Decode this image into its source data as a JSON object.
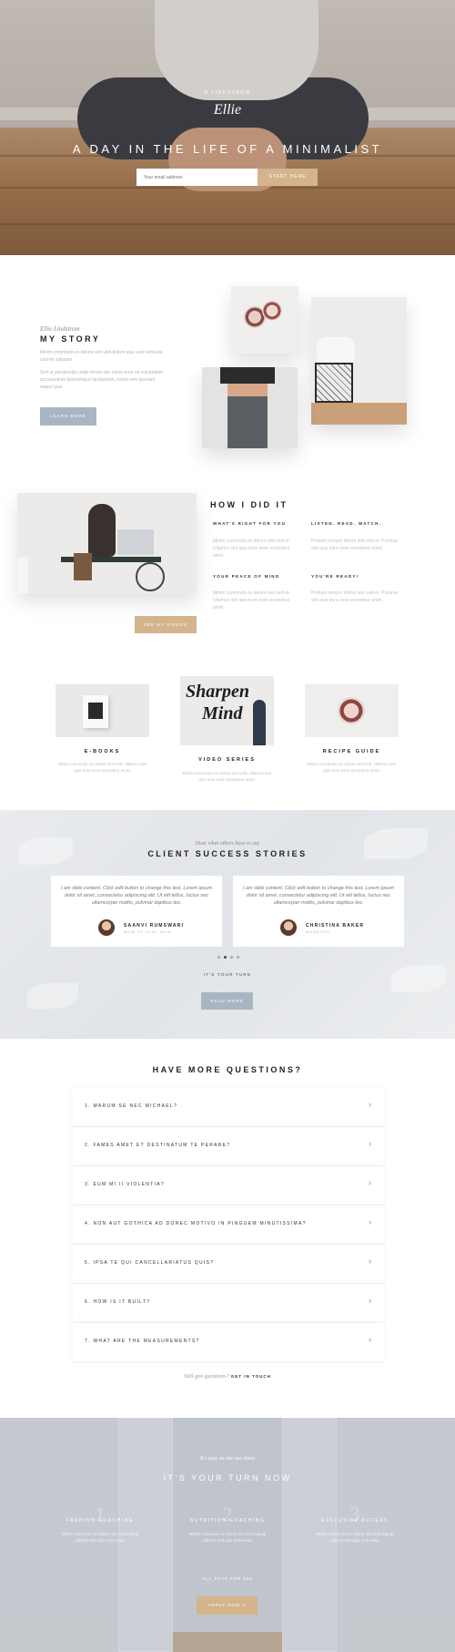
{
  "hero": {
    "byline": "D LINDSTROM",
    "signature": "Ellie",
    "title": "A DAY IN THE LIFE OF A MINIMALIST",
    "email_placeholder": "Your email address",
    "button": "START HERE"
  },
  "story": {
    "signature": "Ellie Lindstrom",
    "title": "MY STORY",
    "p1": "Minim commodo ex dolore sint velit dolore eius sunt vehicula subnet, aliquam.",
    "p2": "Sed ut perspiciatis unde omnis iste natus error sit voluptatem accusantium doloremque laudantium, totam rem aperiam eaque ipsa.",
    "button": "LEARN MORE"
  },
  "how": {
    "title": "HOW I DID IT",
    "items": [
      {
        "heading": "WHAT'S RIGHT FOR YOU",
        "text": "Minim commodo ex dolore sint velit et. Ullamco sint quis irure esse excepteur amet."
      },
      {
        "heading": "LISTEN. READ. WATCH.",
        "text": "Pretium tempor dolore sint velit et. Pulvinar sint quis irure esse excepteur amet."
      },
      {
        "heading": "YOUR PEACE OF MIND",
        "text": "Minim commodo ex dolore sint velit et. Ullamco sint quis irure esse excepteur amet."
      },
      {
        "heading": "YOU'RE READY!",
        "text": "Pretium tempor dolore sint velit et. Pulvinar sint quis irure esse excepteur amet."
      }
    ],
    "button": "SEE MY VIDEOS"
  },
  "products": [
    {
      "title": "E-BOOKS",
      "text": "Minim commodo ex dolore sint velit. Ullamco sint quis irure esse excepteur amet."
    },
    {
      "title": "VIDEO SERIES",
      "text": "Minim commodo ex dolore sint velit. Ullamco sint quis irure esse excepteur amet."
    },
    {
      "title": "RECIPE GUIDE",
      "text": "Minim commodo ex dolore sint velit. Ullamco sint quis irure esse excepteur amet."
    }
  ],
  "video_art": {
    "line1": "Sharpen",
    "line2": "Mind"
  },
  "testimonials": {
    "eyebrow": "Hear what others have to say",
    "title": "CLIENT SUCCESS STORIES",
    "cards": [
      {
        "quote": "I am slide content. Click edit button to change this text. Lorem ipsum dolor sit amet, consectetur adipiscing elit. Ut elit tellus, luctus nec ullamcorper mattis, pulvinar dapibus leo.",
        "name": "SAANVI RUMSWARI",
        "role": "MOM OF GIRL MOM"
      },
      {
        "quote": "I am slide content. Click edit button to change this text. Lorem ipsum dolor sit amet, consectetur adipiscing elit. Ut elit tellus, luctus nec ullamcorper mattis, pulvinar dapibus leo.",
        "name": "CHRISTINA BAKER",
        "role": "MANAGER"
      }
    ],
    "turn": "IT'S YOUR TURN",
    "button": "READ MORE"
  },
  "faq": {
    "title": "HAVE MORE QUESTIONS?",
    "items": [
      "1. MARUM SE NEC MICHAEL?",
      "2. FAMES AMET ET DESTINATUM TE PERARE?",
      "3. EUM MI II VIOLENTIA?",
      "4. NON AUT GOTHICA AD DONEC MOTIVO IN PINGUEM MINUTISSIMA?",
      "5. IPSA TE QUI CANCELLARIATUS QUIS?",
      "6. HOW IS IT BUILT?",
      "7. WHAT ARE THE MEASUREMENTS?"
    ],
    "footer_italic": "Still got questions?",
    "footer_link": "GET IN TOUCH"
  },
  "cta": {
    "eyebrow": "It's easy as one two three",
    "title": "IT'S YOUR TURN NOW",
    "benefits": [
      {
        "num": "1",
        "title": "FASHION COACHING",
        "text": "Minim commodo ex dolore sint velit aliquip ullamco sint quis irure esse."
      },
      {
        "num": "2",
        "title": "NUTRITION COACHING",
        "text": "Minim commodo ex dolore sint velit aliquip ullamco sint quis irure esse."
      },
      {
        "num": "3",
        "title": "EXCLUSIVE ACCESS",
        "text": "Minim commodo ex dolore sint velit aliquip ullamco sint quis irure esse."
      }
    ],
    "link": "ALL THAT FOR $99",
    "button": "APPLY NOW  >"
  }
}
